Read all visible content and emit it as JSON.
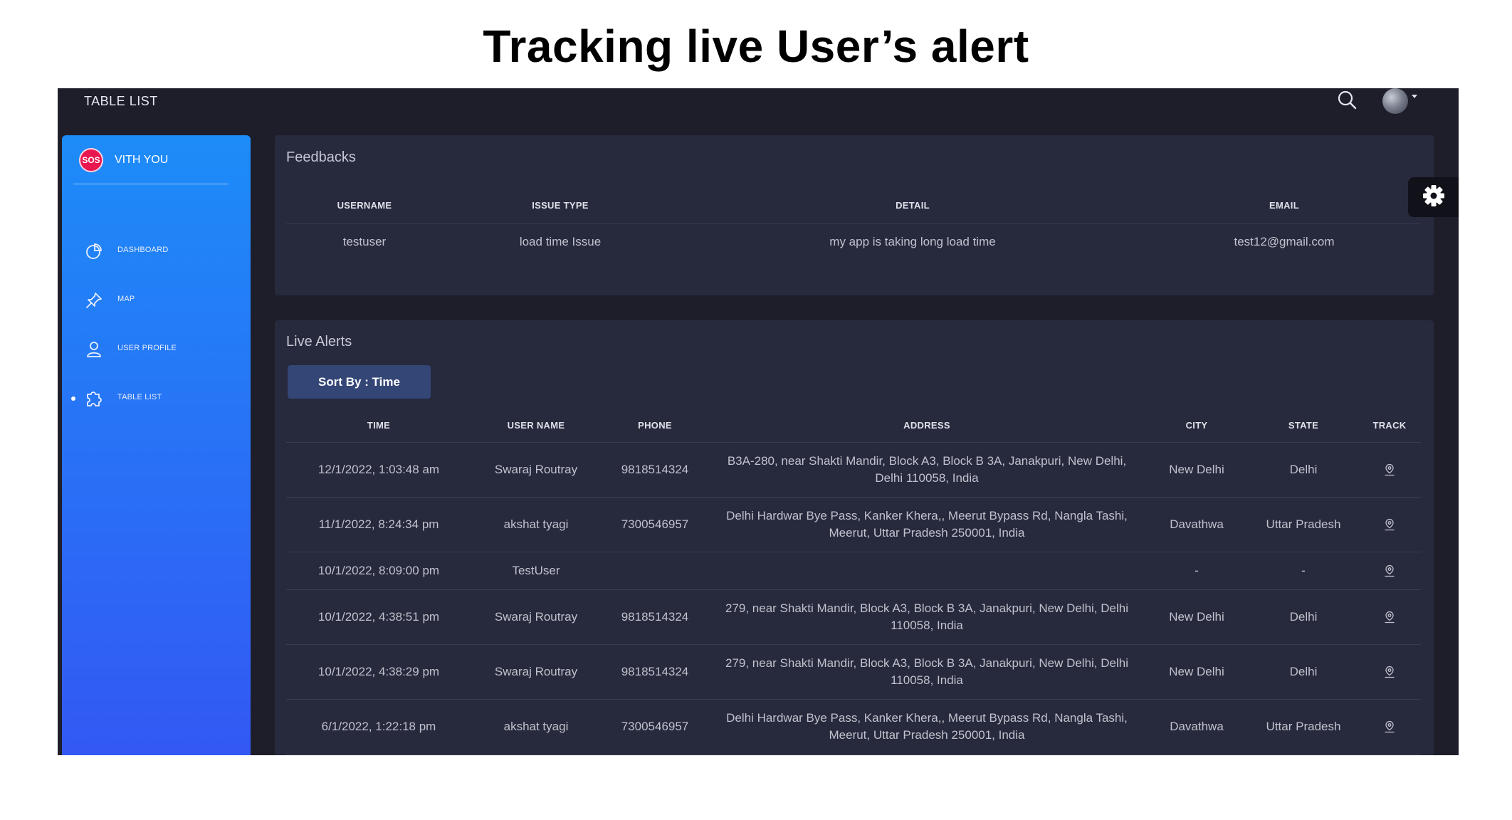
{
  "slide": {
    "title": "Tracking live User’s alert"
  },
  "topbar": {
    "brand": "TABLE LIST",
    "search_icon": "search-icon",
    "avatar_icon": "user-avatar"
  },
  "sidebar": {
    "logo_text": "SOS",
    "app_name": "VITH YOU",
    "items": [
      {
        "label": "DASHBOARD",
        "icon": "pie-chart-icon",
        "active": false
      },
      {
        "label": "MAP",
        "icon": "pin-icon",
        "active": false
      },
      {
        "label": "USER PROFILE",
        "icon": "user-icon",
        "active": false
      },
      {
        "label": "TABLE LIST",
        "icon": "puzzle-icon",
        "active": true
      }
    ]
  },
  "feedbacks": {
    "title": "Feedbacks",
    "headers": [
      "USERNAME",
      "ISSUE TYPE",
      "DETAIL",
      "EMAIL"
    ],
    "rows": [
      [
        "testuser",
        "load time Issue",
        "my app is taking long load time",
        "test12@gmail.com"
      ]
    ]
  },
  "live_alerts": {
    "title": "Live Alerts",
    "sort_label": "Sort By : Time",
    "headers": [
      "TIME",
      "USER NAME",
      "PHONE",
      "ADDRESS",
      "CITY",
      "STATE",
      "TRACK"
    ],
    "rows": [
      {
        "time": "12/1/2022, 1:03:48 am",
        "user": "Swaraj Routray",
        "phone": "9818514324",
        "address": "B3A-280, near Shakti Mandir, Block A3, Block B 3A, Janakpuri, New Delhi, Delhi 110058, India",
        "city": "New Delhi",
        "state": "Delhi"
      },
      {
        "time": "11/1/2022, 8:24:34 pm",
        "user": "akshat tyagi",
        "phone": "7300546957",
        "address": "Delhi Hardwar Bye Pass, Kanker Khera,, Meerut Bypass Rd, Nangla Tashi, Meerut, Uttar Pradesh 250001, India",
        "city": "Davathwa",
        "state": "Uttar Pradesh"
      },
      {
        "time": "10/1/2022, 8:09:00 pm",
        "user": "TestUser",
        "phone": "",
        "address": "",
        "city": "-",
        "state": "-"
      },
      {
        "time": "10/1/2022, 4:38:51 pm",
        "user": "Swaraj Routray",
        "phone": "9818514324",
        "address": "279, near Shakti Mandir, Block A3, Block B 3A, Janakpuri, New Delhi, Delhi 110058, India",
        "city": "New Delhi",
        "state": "Delhi"
      },
      {
        "time": "10/1/2022, 4:38:29 pm",
        "user": "Swaraj Routray",
        "phone": "9818514324",
        "address": "279, near Shakti Mandir, Block A3, Block B 3A, Janakpuri, New Delhi, Delhi 110058, India",
        "city": "New Delhi",
        "state": "Delhi"
      },
      {
        "time": "6/1/2022, 1:22:18 pm",
        "user": "akshat tyagi",
        "phone": "7300546957",
        "address": "Delhi Hardwar Bye Pass, Kanker Khera,, Meerut Bypass Rd, Nangla Tashi, Meerut, Uttar Pradesh 250001, India",
        "city": "Davathwa",
        "state": "Uttar Pradesh"
      }
    ]
  },
  "colors": {
    "sidebar_top": "#1d8cf8",
    "sidebar_bottom": "#3358f4",
    "background": "#1e1e2b",
    "card": "#27293d",
    "sort_button": "#344675",
    "logo": "#e9164f"
  }
}
